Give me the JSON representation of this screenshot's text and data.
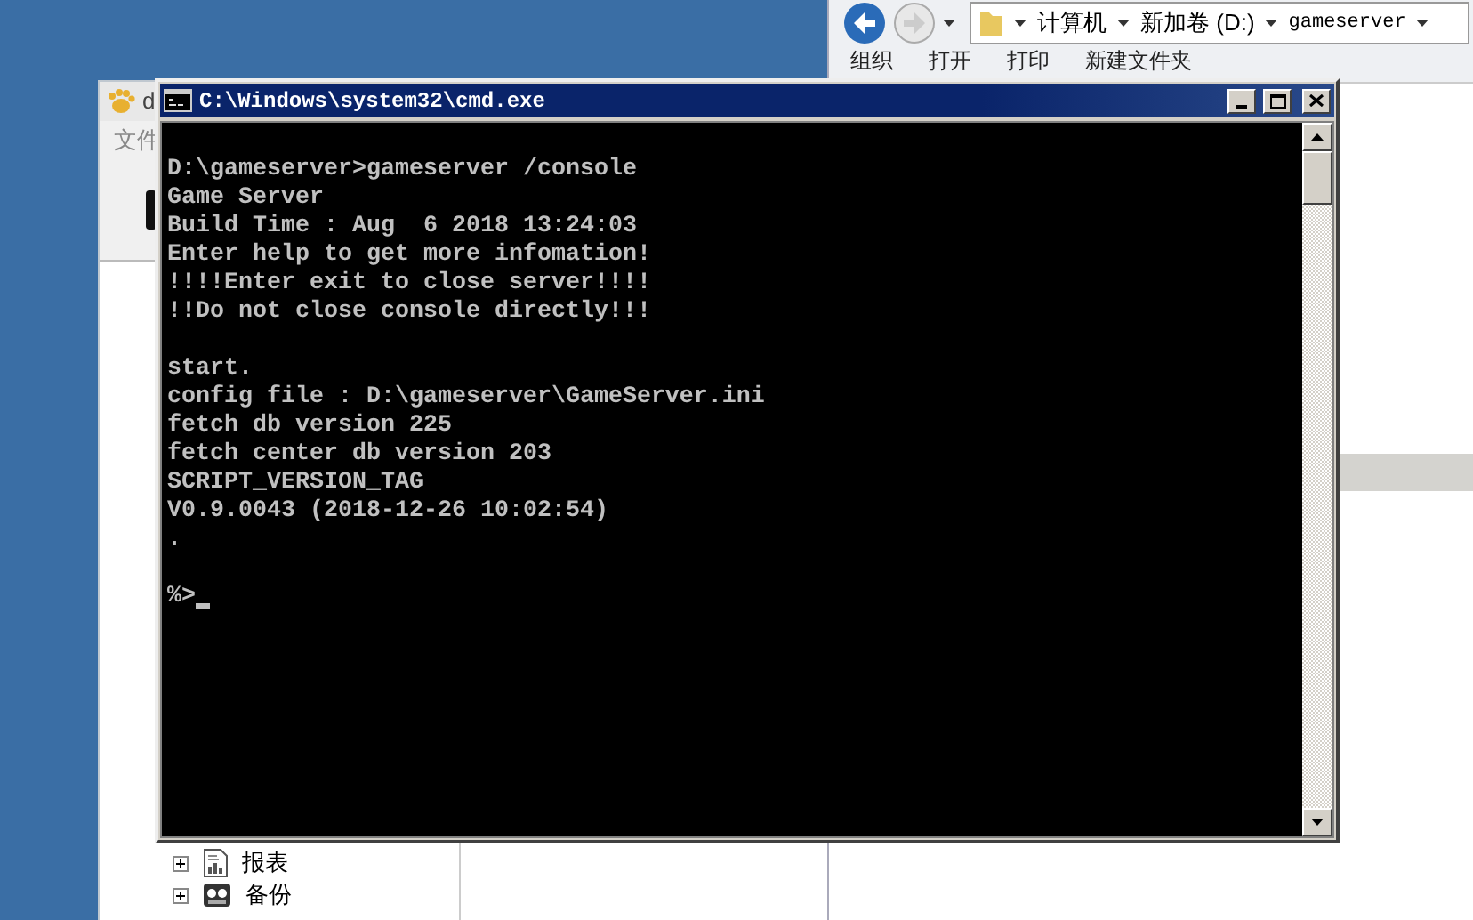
{
  "back_window": {
    "title": "d",
    "menu": [
      "文件"
    ],
    "tree_bottom": [
      {
        "label": "报表",
        "expanded": false,
        "kind": "report"
      },
      {
        "label": "备份",
        "expanded": false,
        "kind": "backup"
      }
    ]
  },
  "explorer": {
    "breadcrumb": [
      "计算机",
      "新加卷 (D:)",
      "gameserver"
    ],
    "toolbar": [
      "组织",
      "打开",
      "打印",
      "新建文件夹"
    ]
  },
  "console": {
    "title": "C:\\Windows\\system32\\cmd.exe",
    "blocks": [
      [
        "D:\\gameserver>gameserver /console",
        "Game Server",
        "Build Time : Aug  6 2018 13:24:03",
        "Enter help to get more infomation!",
        "!!!!Enter exit to close server!!!!",
        "!!Do not close console directly!!!"
      ],
      [
        "start.",
        "config file : D:\\gameserver\\GameServer.ini",
        "fetch db version 225",
        "fetch center db version 203",
        "SCRIPT_VERSION_TAG",
        "V0.9.0043 (2018-12-26 10:02:54)",
        "."
      ],
      [
        "%>"
      ]
    ]
  }
}
